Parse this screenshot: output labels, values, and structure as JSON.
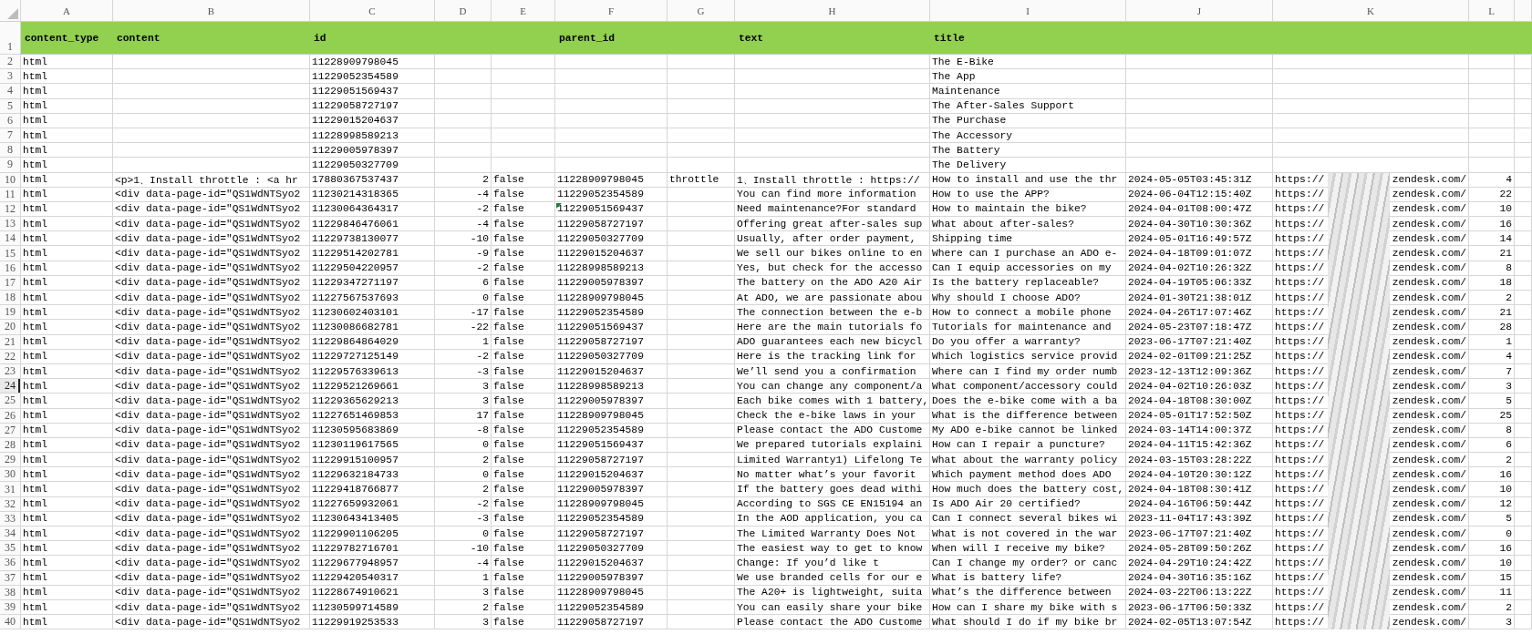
{
  "columns": [
    "A",
    "B",
    "C",
    "D",
    "E",
    "F",
    "G",
    "H",
    "I",
    "J",
    "K",
    "L"
  ],
  "header_row": {
    "n": "1",
    "a": "content_type",
    "b": "content",
    "c": "id",
    "f": "parent_id",
    "h": "text",
    "i": "title"
  },
  "k_redacted": true,
  "rows": [
    {
      "n": "2",
      "a": "html",
      "c": "11228909798045",
      "i": "The E-Bike",
      "selected": false,
      "flagged": false
    },
    {
      "n": "3",
      "a": "html",
      "c": "11229052354589",
      "i": "The App",
      "selected": false,
      "flagged": false
    },
    {
      "n": "4",
      "a": "html",
      "c": "11229051569437",
      "i": "Maintenance",
      "selected": false,
      "flagged": false
    },
    {
      "n": "5",
      "a": "html",
      "c": "11229058727197",
      "i": "The After-Sales Support",
      "selected": false,
      "flagged": false
    },
    {
      "n": "6",
      "a": "html",
      "c": "11229015204637",
      "i": "The Purchase",
      "selected": false,
      "flagged": false
    },
    {
      "n": "7",
      "a": "html",
      "c": "11228998589213",
      "i": "The Accessory",
      "selected": false,
      "flagged": false
    },
    {
      "n": "8",
      "a": "html",
      "c": "11229005978397",
      "i": "The Battery",
      "selected": false,
      "flagged": false
    },
    {
      "n": "9",
      "a": "html",
      "c": "11229050327709",
      "i": "The Delivery",
      "selected": false,
      "flagged": false
    },
    {
      "n": "10",
      "a": "html",
      "b": "<p>1、Install throttle : <a hr",
      "c": "17880367537437",
      "d": "2",
      "e": "false",
      "f": "11228909798045",
      "g": "throttle",
      "h": "1、Install throttle : https://",
      "i": "How to install and use the thr",
      "j": "2024-05-05T03:45:31Z",
      "k_scheme": "https://",
      "k_host": "zendesk.com/",
      "l": "4",
      "selected": false,
      "flagged": false
    },
    {
      "n": "11",
      "a": "html",
      "b": "<div data-page-id=\"QS1WdNTSyo2",
      "c": "11230214318365",
      "d": "-4",
      "e": "false",
      "f": "11229052354589",
      "h": "You can find more information",
      "i": "How to use the APP?",
      "j": "2024-06-04T12:15:40Z",
      "k_scheme": "https://",
      "k_host": "zendesk.com/",
      "l": "22",
      "selected": false,
      "flagged": false
    },
    {
      "n": "12",
      "a": "html",
      "b": "<div data-page-id=\"QS1WdNTSyo2",
      "c": "11230064364317",
      "d": "-2",
      "e": "false",
      "f": "11229051569437",
      "h": "Need maintenance?For standard",
      "i": "How to maintain the bike?",
      "j": "2024-04-01T08:00:47Z",
      "k_scheme": "https://",
      "k_host": "zendesk.com/",
      "l": "10",
      "selected": false,
      "flagged": true
    },
    {
      "n": "13",
      "a": "html",
      "b": "<div data-page-id=\"QS1WdNTSyo2",
      "c": "11229846476061",
      "d": "-4",
      "e": "false",
      "f": "11229058727197",
      "h": "Offering great after-sales sup",
      "i": "What about after-sales?",
      "j": "2024-04-30T10:30:36Z",
      "k_scheme": "https://",
      "k_host": "zendesk.com/",
      "l": "16",
      "selected": false,
      "flagged": false
    },
    {
      "n": "14",
      "a": "html",
      "b": "<div data-page-id=\"QS1WdNTSyo2",
      "c": "11229738130077",
      "d": "-10",
      "e": "false",
      "f": "11229050327709",
      "h": "Usually, after order payment,",
      "i": "Shipping time",
      "j": "2024-05-01T16:49:57Z",
      "k_scheme": "https://",
      "k_host": "zendesk.com/",
      "l": "14",
      "selected": false,
      "flagged": false
    },
    {
      "n": "15",
      "a": "html",
      "b": "<div data-page-id=\"QS1WdNTSyo2",
      "c": "11229514202781",
      "d": "-9",
      "e": "false",
      "f": "11229015204637",
      "h": "We sell our bikes online to en",
      "i": "Where can I purchase an ADO e-",
      "j": "2024-04-18T09:01:07Z",
      "k_scheme": "https://",
      "k_host": "zendesk.com/",
      "l": "21",
      "selected": false,
      "flagged": false
    },
    {
      "n": "16",
      "a": "html",
      "b": "<div data-page-id=\"QS1WdNTSyo2",
      "c": "11229504220957",
      "d": "-2",
      "e": "false",
      "f": "11228998589213",
      "h": "Yes, but check for the accesso",
      "i": "Can I equip accessories on my",
      "j": "2024-04-02T10:26:32Z",
      "k_scheme": "https://",
      "k_host": "zendesk.com/",
      "l": "8",
      "selected": false,
      "flagged": false
    },
    {
      "n": "17",
      "a": "html",
      "b": "<div data-page-id=\"QS1WdNTSyo2",
      "c": "11229347271197",
      "d": "6",
      "e": "false",
      "f": "11229005978397",
      "h": "The battery on the ADO A20 Air",
      "i": "Is the battery replaceable?",
      "j": "2024-04-19T05:06:33Z",
      "k_scheme": "https://",
      "k_host": "zendesk.com/",
      "l": "18",
      "selected": false,
      "flagged": false
    },
    {
      "n": "18",
      "a": "html",
      "b": "<div data-page-id=\"QS1WdNTSyo2",
      "c": "11227567537693",
      "d": "0",
      "e": "false",
      "f": "11228909798045",
      "h": "At ADO, we are passionate abou",
      "i": "Why should I choose ADO?",
      "j": "2024-01-30T21:38:01Z",
      "k_scheme": "https://",
      "k_host": "zendesk.com/",
      "l": "2",
      "selected": false,
      "flagged": false
    },
    {
      "n": "19",
      "a": "html",
      "b": "<div data-page-id=\"QS1WdNTSyo2",
      "c": "11230602403101",
      "d": "-17",
      "e": "false",
      "f": "11229052354589",
      "h": "The connection between the e-b",
      "i": "How to connect a mobile phone",
      "j": "2024-04-26T17:07:46Z",
      "k_scheme": "https://",
      "k_host": "zendesk.com/",
      "l": "21",
      "selected": false,
      "flagged": false
    },
    {
      "n": "20",
      "a": "html",
      "b": "<div data-page-id=\"QS1WdNTSyo2",
      "c": "11230086682781",
      "d": "-22",
      "e": "false",
      "f": "11229051569437",
      "h": "Here are the main tutorials fo",
      "i": "Tutorials for maintenance and",
      "j": "2024-05-23T07:18:47Z",
      "k_scheme": "https://",
      "k_host": "zendesk.com/",
      "l": "28",
      "selected": false,
      "flagged": false
    },
    {
      "n": "21",
      "a": "html",
      "b": "<div data-page-id=\"QS1WdNTSyo2",
      "c": "11229864864029",
      "d": "1",
      "e": "false",
      "f": "11229058727197",
      "h": "ADO guarantees each new bicycl",
      "i": "Do you offer a warranty?",
      "j": "2023-06-17T07:21:40Z",
      "k_scheme": "https://",
      "k_host": "zendesk.com/",
      "l": "1",
      "selected": false,
      "flagged": false
    },
    {
      "n": "22",
      "a": "html",
      "b": "<div data-page-id=\"QS1WdNTSyo2",
      "c": "11229727125149",
      "d": "-2",
      "e": "false",
      "f": "11229050327709",
      "h": "Here is the tracking link for",
      "i": "Which logistics service provid",
      "j": "2024-02-01T09:21:25Z",
      "k_scheme": "https://",
      "k_host": "zendesk.com/",
      "l": "4",
      "selected": false,
      "flagged": false
    },
    {
      "n": "23",
      "a": "html",
      "b": "<div data-page-id=\"QS1WdNTSyo2",
      "c": "11229576339613",
      "d": "-3",
      "e": "false",
      "f": "11229015204637",
      "h": "We’ll send you a confirmation",
      "i": "Where can I find my order numb",
      "j": "2023-12-13T12:09:36Z",
      "k_scheme": "https://",
      "k_host": "zendesk.com/",
      "l": "7",
      "selected": false,
      "flagged": false
    },
    {
      "n": "24",
      "a": "html",
      "b": "<div data-page-id=\"QS1WdNTSyo2",
      "c": "11229521269661",
      "d": "3",
      "e": "false",
      "f": "11228998589213",
      "h": "You can change any component/a",
      "i": "What component/accessory could",
      "j": "2024-04-02T10:26:03Z",
      "k_scheme": "https://",
      "k_host": "zendesk.com/",
      "l": "3",
      "selected": true,
      "flagged": false
    },
    {
      "n": "25",
      "a": "html",
      "b": "<div data-page-id=\"QS1WdNTSyo2",
      "c": "11229365629213",
      "d": "3",
      "e": "false",
      "f": "11229005978397",
      "h": "Each bike comes with 1 battery,",
      "i": "Does the e-bike come with a ba",
      "j": "2024-04-18T08:30:00Z",
      "k_scheme": "https://",
      "k_host": "zendesk.com/",
      "l": "5",
      "selected": false,
      "flagged": false
    },
    {
      "n": "26",
      "a": "html",
      "b": "<div data-page-id=\"QS1WdNTSyo2",
      "c": "11227651469853",
      "d": "17",
      "e": "false",
      "f": "11228909798045",
      "h": "Check the e-bike laws in your",
      "i": "What is the difference between",
      "j": "2024-05-01T17:52:50Z",
      "k_scheme": "https://",
      "k_host": "zendesk.com/",
      "l": "25",
      "selected": false,
      "flagged": false
    },
    {
      "n": "27",
      "a": "html",
      "b": "<div data-page-id=\"QS1WdNTSyo2",
      "c": "11230595683869",
      "d": "-8",
      "e": "false",
      "f": "11229052354589",
      "h": "Please contact the ADO Custome",
      "i": "My ADO e-bike cannot be linked",
      "j": "2024-03-14T14:00:37Z",
      "k_scheme": "https://",
      "k_host": "zendesk.com/",
      "l": "8",
      "selected": false,
      "flagged": false
    },
    {
      "n": "28",
      "a": "html",
      "b": "<div data-page-id=\"QS1WdNTSyo2",
      "c": "11230119617565",
      "d": "0",
      "e": "false",
      "f": "11229051569437",
      "h": "We prepared tutorials explaini",
      "i": "How can I repair a puncture?",
      "j": "2024-04-11T15:42:36Z",
      "k_scheme": "https://",
      "k_host": "zendesk.com/",
      "l": "6",
      "selected": false,
      "flagged": false
    },
    {
      "n": "29",
      "a": "html",
      "b": "<div data-page-id=\"QS1WdNTSyo2",
      "c": "11229915100957",
      "d": "2",
      "e": "false",
      "f": "11229058727197",
      "h": "Limited Warranty1) Lifelong Te",
      "i": "What about the warranty policy",
      "j": "2024-03-15T03:28:22Z",
      "k_scheme": "https://",
      "k_host": "zendesk.com/",
      "l": "2",
      "selected": false,
      "flagged": false
    },
    {
      "n": "30",
      "a": "html",
      "b": "<div data-page-id=\"QS1WdNTSyo2",
      "c": "11229632184733",
      "d": "0",
      "e": "false",
      "f": "11229015204637",
      "h": "No matter what’s your favorit",
      "i": "Which payment method does ADO",
      "j": "2024-04-10T20:30:12Z",
      "k_scheme": "https://",
      "k_host": "zendesk.com/",
      "l": "16",
      "selected": false,
      "flagged": false
    },
    {
      "n": "31",
      "a": "html",
      "b": "<div data-page-id=\"QS1WdNTSyo2",
      "c": "11229418766877",
      "d": "2",
      "e": "false",
      "f": "11229005978397",
      "h": "If the battery goes dead withi",
      "i": "How much does the battery cost,",
      "j": "2024-04-18T08:30:41Z",
      "k_scheme": "https://",
      "k_host": "zendesk.com/",
      "l": "10",
      "selected": false,
      "flagged": false
    },
    {
      "n": "32",
      "a": "html",
      "b": "<div data-page-id=\"QS1WdNTSyo2",
      "c": "11227659932061",
      "d": "-2",
      "e": "false",
      "f": "11228909798045",
      "h": "According to SGS CE EN15194 an",
      "i": "Is ADO Air 20 certified?",
      "j": "2024-04-16T06:59:44Z",
      "k_scheme": "https://",
      "k_host": "zendesk.com/",
      "l": "12",
      "selected": false,
      "flagged": false
    },
    {
      "n": "33",
      "a": "html",
      "b": "<div data-page-id=\"QS1WdNTSyo2",
      "c": "11230643413405",
      "d": "-3",
      "e": "false",
      "f": "11229052354589",
      "h": "In the AOD application, you ca",
      "i": "Can I connect several bikes wi",
      "j": "2023-11-04T17:43:39Z",
      "k_scheme": "https://",
      "k_host": "zendesk.com/",
      "l": "5",
      "selected": false,
      "flagged": false
    },
    {
      "n": "34",
      "a": "html",
      "b": "<div data-page-id=\"QS1WdNTSyo2",
      "c": "11229901106205",
      "d": "0",
      "e": "false",
      "f": "11229058727197",
      "h": "The Limited Warranty Does Not",
      "i": "What is not covered in the war",
      "j": "2023-06-17T07:21:40Z",
      "k_scheme": "https://",
      "k_host": "zendesk.com/",
      "l": "0",
      "selected": false,
      "flagged": false
    },
    {
      "n": "35",
      "a": "html",
      "b": "<div data-page-id=\"QS1WdNTSyo2",
      "c": "11229782716701",
      "d": "-10",
      "e": "false",
      "f": "11229050327709",
      "h": "The easiest way to get to know",
      "i": "When will I receive my bike?",
      "j": "2024-05-28T09:50:26Z",
      "k_scheme": "https://",
      "k_host": "zendesk.com/",
      "l": "16",
      "selected": false,
      "flagged": false
    },
    {
      "n": "36",
      "a": "html",
      "b": "<div data-page-id=\"QS1WdNTSyo2",
      "c": "11229677948957",
      "d": "-4",
      "e": "false",
      "f": "11229015204637",
      "h": "Change:       If you’d like t",
      "i": "Can I change my order? or canc",
      "j": "2024-04-29T10:24:42Z",
      "k_scheme": "https://",
      "k_host": "zendesk.com/",
      "l": "10",
      "selected": false,
      "flagged": false
    },
    {
      "n": "37",
      "a": "html",
      "b": "<div data-page-id=\"QS1WdNTSyo2",
      "c": "11229420540317",
      "d": "1",
      "e": "false",
      "f": "11229005978397",
      "h": "We use branded cells for our e",
      "i": "What is battery life?",
      "j": "2024-04-30T16:35:16Z",
      "k_scheme": "https://",
      "k_host": "zendesk.com/",
      "l": "15",
      "selected": false,
      "flagged": false
    },
    {
      "n": "38",
      "a": "html",
      "b": "<div data-page-id=\"QS1WdNTSyo2",
      "c": "11228674910621",
      "d": "3",
      "e": "false",
      "f": "11228909798045",
      "h": "The A20+ is lightweight, suita",
      "i": "What’s the difference between",
      "j": "2024-03-22T06:13:22Z",
      "k_scheme": "https://",
      "k_host": "zendesk.com/",
      "l": "11",
      "selected": false,
      "flagged": false
    },
    {
      "n": "39",
      "a": "html",
      "b": "<div data-page-id=\"QS1WdNTSyo2",
      "c": "11230599714589",
      "d": "2",
      "e": "false",
      "f": "11229052354589",
      "h": "You can easily share your bike",
      "i": "How can I share my bike with s",
      "j": "2023-06-17T06:50:33Z",
      "k_scheme": "https://",
      "k_host": "zendesk.com/",
      "l": "2",
      "selected": false,
      "flagged": false
    },
    {
      "n": "40",
      "a": "html",
      "b": "<div data-page-id=\"QS1WdNTSyo2",
      "c": "11229919253533",
      "d": "3",
      "e": "false",
      "f": "11229058727197",
      "h": "Please contact the ADO Custome",
      "i": "What should I do if my bike br",
      "j": "2024-02-05T13:07:54Z",
      "k_scheme": "https://",
      "k_host": "zendesk.com/",
      "l": "3",
      "selected": false,
      "flagged": false
    }
  ]
}
